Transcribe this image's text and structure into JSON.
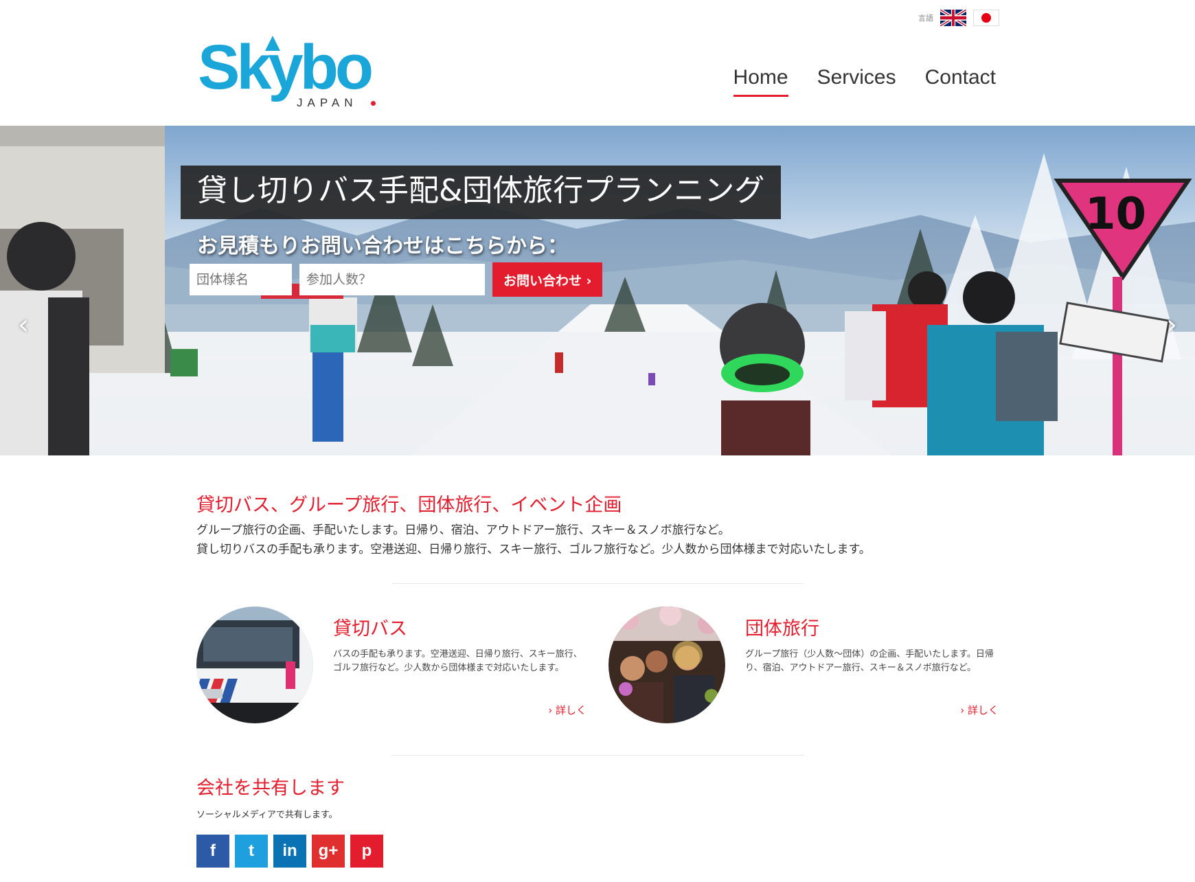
{
  "header": {
    "language_label": "言語",
    "logo": {
      "name": "Skybo",
      "sub": "JAPAN"
    },
    "nav": [
      {
        "label": "Home",
        "active": true
      },
      {
        "label": "Services",
        "active": false
      },
      {
        "label": "Contact",
        "active": false
      }
    ]
  },
  "hero": {
    "title": "貸し切りバス手配&団体旅行プランニング",
    "subtitle": "お見積もりお問い合わせはこちらから：",
    "group_placeholder": "団体様名",
    "count_placeholder": "参加人数？",
    "button_label": "お問い合わせ ›",
    "prev": "‹",
    "next": "›"
  },
  "intro": {
    "title": "貸切バス、グループ旅行、団体旅行、イベント企画",
    "line1": "グループ旅行の企画、手配いたします。日帰り、宿泊、アウトドアー旅行、スキー＆スノボ旅行など。",
    "line2": "貸し切りバスの手配も承ります。空港送迎、日帰り旅行、スキー旅行、ゴルフ旅行など。少人数から団体様まで対応いたします。"
  },
  "services": [
    {
      "title": "貸切バス",
      "text": "バスの手配も承ります。空港送迎、日帰り旅行、スキー旅行、ゴルフ旅行など。少人数から団体様まで対応いたします。",
      "more": "› 詳しく"
    },
    {
      "title": "団体旅行",
      "text": "グループ旅行（少人数〜団体）の企画、手配いたします。日帰り、宿泊、アウトドアー旅行、スキー＆スノボ旅行など。",
      "more": "› 詳しく"
    }
  ],
  "share": {
    "title": "会社を共有します",
    "text": "ソーシャルメディアで共有します。",
    "icons": [
      "f",
      "t",
      "in",
      "g+",
      "p"
    ]
  },
  "colors": {
    "accent": "#e31d2d",
    "brand": "#1aa6d9"
  }
}
